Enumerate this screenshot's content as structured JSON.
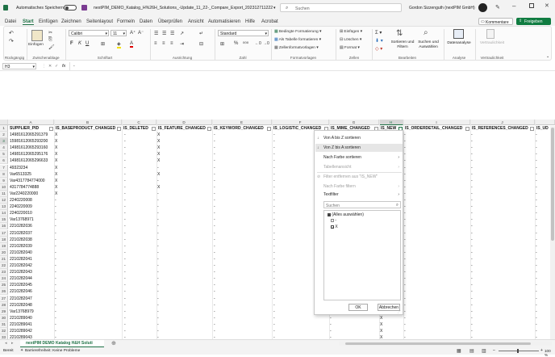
{
  "title_bar": {
    "autosave_label": "Automatisches Speichern",
    "filename": "nextPIM_DEMO_Katalog_H%26H_Solutions_-Update_11_22-_Compare_Export_2023127112227.xlsx",
    "search_placeholder": "Suchen",
    "user": "Gordon Sizzenguth (nextPIM GmbH)"
  },
  "ribbon_tabs": [
    "Datei",
    "Start",
    "Einfügen",
    "Zeichnen",
    "Seitenlayout",
    "Formeln",
    "Daten",
    "Überprüfen",
    "Ansicht",
    "Automatisieren",
    "Hilfe",
    "Acrobat"
  ],
  "ribbon_right": {
    "comments": "Kommentare",
    "share": "Freigeben"
  },
  "ribbon": {
    "undo_group": "Rückgängig",
    "clipboard_group": "Zwischenablage",
    "paste": "Einfügen",
    "font_group": "Schriftart",
    "font_name": "Calibri",
    "font_size": "11",
    "align_group": "Ausrichtung",
    "number_group": "Zahl",
    "number_format": "Standard",
    "cond_format": "Bedingte Formatierung",
    "as_table": "Als Tabelle formatieren",
    "cell_styles": "Zellenformatvorlagen",
    "styles_group": "Formatvorlagen",
    "insert": "Einfügen",
    "delete": "Löschen",
    "format": "Format",
    "cells_group": "Zellen",
    "sort_filter": "Sortieren und Filtern",
    "find_select": "Suchen und Auswählen",
    "edit_group": "Bearbeiten",
    "data_analysis": "Datenanalyse",
    "analysis_group": "Analyse",
    "sensitivity": "Vertraulichkeit",
    "sensitivity_group": "Vertraulichkeit"
  },
  "formula_bar": {
    "name_box": "H3",
    "fx": "fx",
    "value": "-"
  },
  "columns": [
    "A",
    "B",
    "C",
    "D",
    "E",
    "F",
    "G",
    "H",
    "I",
    "J"
  ],
  "header_row": [
    "SUPPLIER_PID",
    "IS_BASEPRODUCT_CHANGED",
    "IS_DELETED",
    "IS_FEATURE_CHANGED",
    "IS_KEYWORD_CHANGED",
    "IS_LOGISTIC_CHANGED",
    "IS_MIME_CHANGED",
    "IS_NEW",
    "IS_ORDERDETAIL_CHANGED",
    "IS_REFERENCES_CHANGED",
    "IS_UD"
  ],
  "rows": [
    {
      "n": "2",
      "a": "14981612065291379",
      "b": "X",
      "c": "-",
      "d": "X",
      "e": "-",
      "f": "-",
      "g": "-",
      "h": "-",
      "i": "-",
      "j": "-",
      "k": "-"
    },
    {
      "n": "3",
      "a": "15981612065293200",
      "b": "X",
      "c": "-",
      "d": "X",
      "e": "-",
      "f": "-",
      "g": "-",
      "h": "-",
      "i": "-",
      "j": "-",
      "k": "-"
    },
    {
      "n": "4",
      "a": "14981612065293160",
      "b": "X",
      "c": "-",
      "d": "X",
      "e": "-",
      "f": "-",
      "g": "-",
      "h": "-",
      "i": "-",
      "j": "-",
      "k": "-"
    },
    {
      "n": "5",
      "a": "14981612065295176",
      "b": "X",
      "c": "-",
      "d": "X",
      "e": "-",
      "f": "-",
      "g": "-",
      "h": "-",
      "i": "-",
      "j": "-",
      "k": "-"
    },
    {
      "n": "6",
      "a": "14981612065296633",
      "b": "X",
      "c": "-",
      "d": "X",
      "e": "-",
      "f": "-",
      "g": "-",
      "h": "-",
      "i": "-",
      "j": "-",
      "k": "-"
    },
    {
      "n": "7",
      "a": "49323234",
      "b": "X",
      "c": "-",
      "d": "-",
      "e": "-",
      "f": "-",
      "g": "-",
      "h": "-",
      "i": "-",
      "j": "-",
      "k": "-"
    },
    {
      "n": "8",
      "a": "Var6513325",
      "b": "X",
      "c": "-",
      "d": "X",
      "e": "-",
      "f": "-",
      "g": "-",
      "h": "-",
      "i": "-",
      "j": "-",
      "k": "-"
    },
    {
      "n": "9",
      "a": "Var4317784774000",
      "b": "X",
      "c": "-",
      "d": "-",
      "e": "-",
      "f": "-",
      "g": "-",
      "h": "-",
      "i": "-",
      "j": "-",
      "k": "-"
    },
    {
      "n": "10",
      "a": "4317784774888",
      "b": "X",
      "c": "-",
      "d": "X",
      "e": "-",
      "f": "-",
      "g": "-",
      "h": "-",
      "i": "-",
      "j": "-",
      "k": "-"
    },
    {
      "n": "11",
      "a": "Var2240220000",
      "b": "X",
      "c": "-",
      "d": "-",
      "e": "-",
      "f": "-",
      "g": "-",
      "h": "-",
      "i": "-",
      "j": "-",
      "k": "-"
    },
    {
      "n": "12",
      "a": "2240220008",
      "b": "-",
      "c": "-",
      "d": "-",
      "e": "-",
      "f": "-",
      "g": "-",
      "h": "-",
      "i": "-",
      "j": "-",
      "k": "-"
    },
    {
      "n": "13",
      "a": "2240220009",
      "b": "-",
      "c": "-",
      "d": "-",
      "e": "-",
      "f": "-",
      "g": "-",
      "h": "-",
      "i": "-",
      "j": "-",
      "k": "-"
    },
    {
      "n": "14",
      "a": "2240220010",
      "b": "-",
      "c": "-",
      "d": "-",
      "e": "-",
      "f": "-",
      "g": "-",
      "h": "-",
      "i": "-",
      "j": "-",
      "k": "-"
    },
    {
      "n": "15",
      "a": "Var13768971",
      "b": "-",
      "c": "-",
      "d": "-",
      "e": "-",
      "f": "-",
      "g": "-",
      "h": "-",
      "i": "-",
      "j": "-",
      "k": "-"
    },
    {
      "n": "16",
      "a": "2210282036",
      "b": "-",
      "c": "-",
      "d": "-",
      "e": "-",
      "f": "-",
      "g": "-",
      "h": "-",
      "i": "-",
      "j": "-",
      "k": "-"
    },
    {
      "n": "17",
      "a": "2210282037",
      "b": "-",
      "c": "-",
      "d": "-",
      "e": "-",
      "f": "-",
      "g": "-",
      "h": "-",
      "i": "-",
      "j": "-",
      "k": "-"
    },
    {
      "n": "18",
      "a": "2210282038",
      "b": "-",
      "c": "-",
      "d": "-",
      "e": "-",
      "f": "-",
      "g": "-",
      "h": "-",
      "i": "-",
      "j": "-",
      "k": "-"
    },
    {
      "n": "19",
      "a": "2210282039",
      "b": "-",
      "c": "-",
      "d": "-",
      "e": "-",
      "f": "-",
      "g": "-",
      "h": "-",
      "i": "-",
      "j": "-",
      "k": "-"
    },
    {
      "n": "20",
      "a": "2210282040",
      "b": "-",
      "c": "-",
      "d": "-",
      "e": "-",
      "f": "-",
      "g": "-",
      "h": "-",
      "i": "-",
      "j": "-",
      "k": "-"
    },
    {
      "n": "21",
      "a": "2210282041",
      "b": "-",
      "c": "-",
      "d": "-",
      "e": "-",
      "f": "-",
      "g": "-",
      "h": "-",
      "i": "-",
      "j": "-",
      "k": "-"
    },
    {
      "n": "22",
      "a": "2210282042",
      "b": "-",
      "c": "-",
      "d": "-",
      "e": "-",
      "f": "-",
      "g": "-",
      "h": "-",
      "i": "-",
      "j": "-",
      "k": "-"
    },
    {
      "n": "23",
      "a": "2210282043",
      "b": "-",
      "c": "-",
      "d": "-",
      "e": "-",
      "f": "-",
      "g": "-",
      "h": "-",
      "i": "-",
      "j": "-",
      "k": "-"
    },
    {
      "n": "24",
      "a": "2210282044",
      "b": "-",
      "c": "-",
      "d": "-",
      "e": "-",
      "f": "-",
      "g": "-",
      "h": "-",
      "i": "-",
      "j": "-",
      "k": "-"
    },
    {
      "n": "25",
      "a": "2210282045",
      "b": "-",
      "c": "-",
      "d": "-",
      "e": "-",
      "f": "-",
      "g": "-",
      "h": "-",
      "i": "-",
      "j": "-",
      "k": "-"
    },
    {
      "n": "26",
      "a": "2210282046",
      "b": "-",
      "c": "-",
      "d": "-",
      "e": "-",
      "f": "-",
      "g": "-",
      "h": "-",
      "i": "-",
      "j": "-",
      "k": "-"
    },
    {
      "n": "27",
      "a": "2210282047",
      "b": "-",
      "c": "-",
      "d": "-",
      "e": "-",
      "f": "-",
      "g": "-",
      "h": "-",
      "i": "-",
      "j": "-",
      "k": "-"
    },
    {
      "n": "28",
      "a": "2210282048",
      "b": "-",
      "c": "-",
      "d": "-",
      "e": "-",
      "f": "-",
      "g": "-",
      "h": "-",
      "i": "-",
      "j": "-",
      "k": "-"
    },
    {
      "n": "29",
      "a": "Var13768979",
      "b": "-",
      "c": "-",
      "d": "-",
      "e": "-",
      "f": "-",
      "g": "-",
      "h": "-",
      "i": "-",
      "j": "-",
      "k": "-"
    },
    {
      "n": "30",
      "a": "2210289040",
      "b": "-",
      "c": "-",
      "d": "-",
      "e": "-",
      "f": "-",
      "g": "-",
      "h": "X",
      "i": "-",
      "j": "-",
      "k": "-"
    },
    {
      "n": "31",
      "a": "2210289041",
      "b": "-",
      "c": "-",
      "d": "-",
      "e": "-",
      "f": "-",
      "g": "-",
      "h": "X",
      "i": "-",
      "j": "-",
      "k": "-"
    },
    {
      "n": "32",
      "a": "2210289042",
      "b": "-",
      "c": "-",
      "d": "-",
      "e": "-",
      "f": "-",
      "g": "-",
      "h": "X",
      "i": "-",
      "j": "-",
      "k": "-"
    },
    {
      "n": "33",
      "a": "2210289043",
      "b": "-",
      "c": "-",
      "d": "-",
      "e": "-",
      "f": "-",
      "g": "-",
      "h": "X",
      "i": "-",
      "j": "-",
      "k": "-"
    }
  ],
  "filter_menu": {
    "sort_az": "Von A bis Z sortieren",
    "sort_za": "Von Z bis A sortieren",
    "sort_color": "Nach Farbe sortieren",
    "sheet_view": "Tabellenansicht",
    "clear_filter": "Filter entfernen aus \"IS_NEW\"",
    "filter_color": "Nach Farbe filtern",
    "text_filter": "Textfilter",
    "search_placeholder": "Suchen",
    "items": [
      "(Alles auswählen)",
      "-",
      "X"
    ],
    "ok": "OK",
    "cancel": "Abbrechen"
  },
  "sheet_tab": "nextPIM DEMO Katalog H&H Soluti",
  "status": {
    "ready": "Bereit",
    "accessibility": "Barrierefreiheit: Keine Probleme",
    "zoom": "100 %"
  },
  "colors": {
    "excel_green": "#1e7145",
    "share_green": "#107c41"
  }
}
